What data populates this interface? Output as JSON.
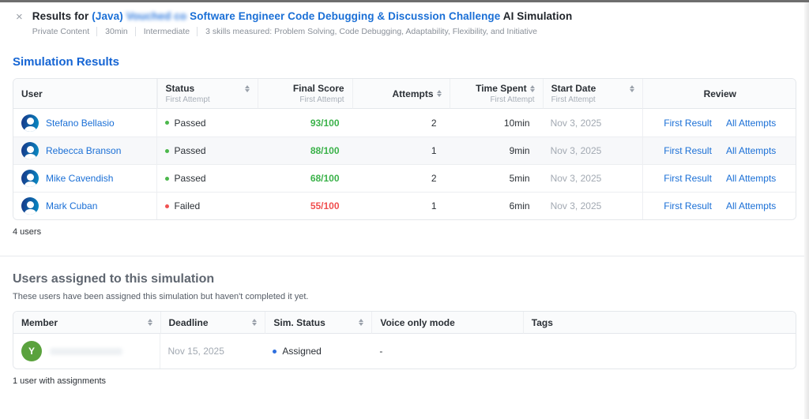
{
  "header": {
    "close": "×",
    "title": {
      "prefix": "Results for ",
      "java_link": "(Java) ",
      "blurred_text": "Vouched co",
      "main_link": " Software Engineer Code Debugging & Discussion Challenge",
      "suffix": " AI Simulation"
    },
    "meta": [
      "Private Content",
      "30min",
      "Intermediate",
      "3 skills measured: Problem Solving, Code Debugging, Adaptability, Flexibility, and Initiative"
    ]
  },
  "results": {
    "heading": "Simulation Results",
    "columns": {
      "user": "User",
      "status": "Status",
      "final_score": "Final Score",
      "attempts": "Attempts",
      "time_spent": "Time Spent",
      "start_date": "Start Date",
      "review": "Review",
      "sub_first_attempt": "First Attempt"
    },
    "review_links": {
      "first": "First Result",
      "all": "All Attempts"
    },
    "rows": [
      {
        "name": "Stefano Bellasio",
        "status": "Passed",
        "score": "93/100",
        "attempts": "2",
        "time_spent": "10min",
        "start_date": "Nov 3, 2025"
      },
      {
        "name": "Rebecca Branson",
        "status": "Passed",
        "score": "88/100",
        "attempts": "1",
        "time_spent": "9min",
        "start_date": "Nov 3, 2025"
      },
      {
        "name": "Mike Cavendish",
        "status": "Passed",
        "score": "68/100",
        "attempts": "2",
        "time_spent": "5min",
        "start_date": "Nov 3, 2025"
      },
      {
        "name": "Mark Cuban",
        "status": "Failed",
        "score": "55/100",
        "attempts": "1",
        "time_spent": "6min",
        "start_date": "Nov 3, 2025"
      }
    ],
    "footer": "4 users"
  },
  "assigned": {
    "heading": "Users assigned to this simulation",
    "subtitle": "These users have been assigned this simulation but haven't completed it yet.",
    "columns": {
      "member": "Member",
      "deadline": "Deadline",
      "sim_status": "Sim. Status",
      "voice": "Voice only mode",
      "tags": "Tags"
    },
    "row": {
      "initial": "Y",
      "deadline": "Nov 15, 2025",
      "status": "Assigned",
      "voice": "-"
    },
    "footer": "1 user with assignments"
  },
  "colors": {
    "link_blue": "#1a6fd6",
    "heading_blue": "#1565d4",
    "pass_green": "#3bb24a",
    "fail_red": "#f04f4f",
    "assigned_dot_blue": "#2f6fde",
    "avatar_green": "#5aa23d"
  }
}
